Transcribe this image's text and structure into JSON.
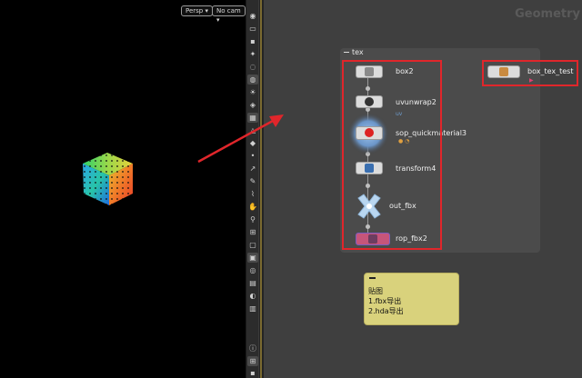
{
  "viewport": {
    "camera_mode": "Persp ▾",
    "camera_select": "No cam ▾"
  },
  "network": {
    "context_title": "Geometry",
    "netbox_title": "tex",
    "nodes": [
      {
        "label": "box2"
      },
      {
        "label": "uvunwrap2",
        "sub": "uv"
      },
      {
        "label": "sop_quickmaterial3"
      },
      {
        "label": "transform4"
      },
      {
        "label": "out_fbx"
      },
      {
        "label": "rop_fbx2"
      }
    ],
    "hda_node": {
      "label": "box_tex_test"
    }
  },
  "sticky_note": {
    "line1": "贴图",
    "line2": "1.fbx导出",
    "line3": "2.hda导出"
  },
  "colors": {
    "annotation": "#e0262b",
    "sticky": "#d9d27c",
    "network_bg": "#3f3f3f"
  }
}
